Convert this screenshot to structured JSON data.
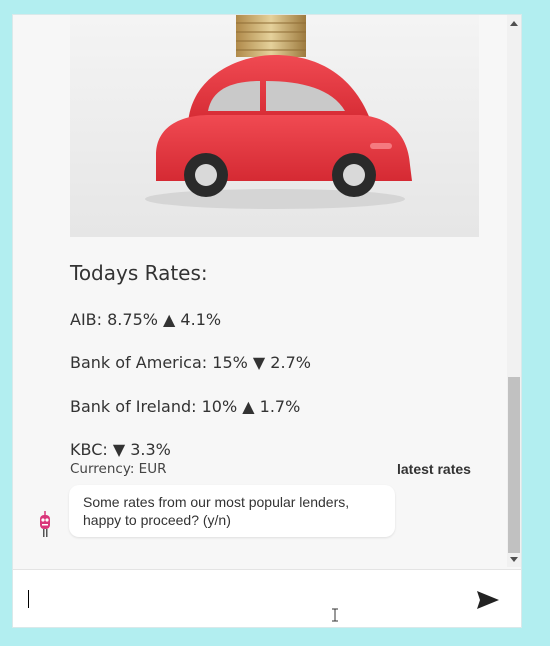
{
  "rates_card": {
    "title": "Todays Rates:",
    "rates": [
      {
        "text": "AIB: 8.75% ▲ 4.1%"
      },
      {
        "text": "Bank of America: 15% ▼ 2.7%"
      },
      {
        "text": "Bank of Ireland: 10% ▲ 1.7%"
      },
      {
        "text": "KBC: ▼ 3.3%"
      }
    ],
    "currency": "Currency: EUR",
    "action_label": "latest rates"
  },
  "bot_message": {
    "text": "Some rates from our most popular lenders, happy to proceed? (y/n)"
  },
  "input": {
    "value": "",
    "placeholder": ""
  },
  "icons": {
    "send": "send-icon",
    "avatar": "bot-avatar-icon",
    "scroll_up": "arrow-up-icon",
    "scroll_down": "arrow-down-icon"
  },
  "colors": {
    "page_background": "#b2eef0",
    "chat_background": "#f7f7f7",
    "car_red": "#e8363f",
    "send_icon": "#222222"
  }
}
